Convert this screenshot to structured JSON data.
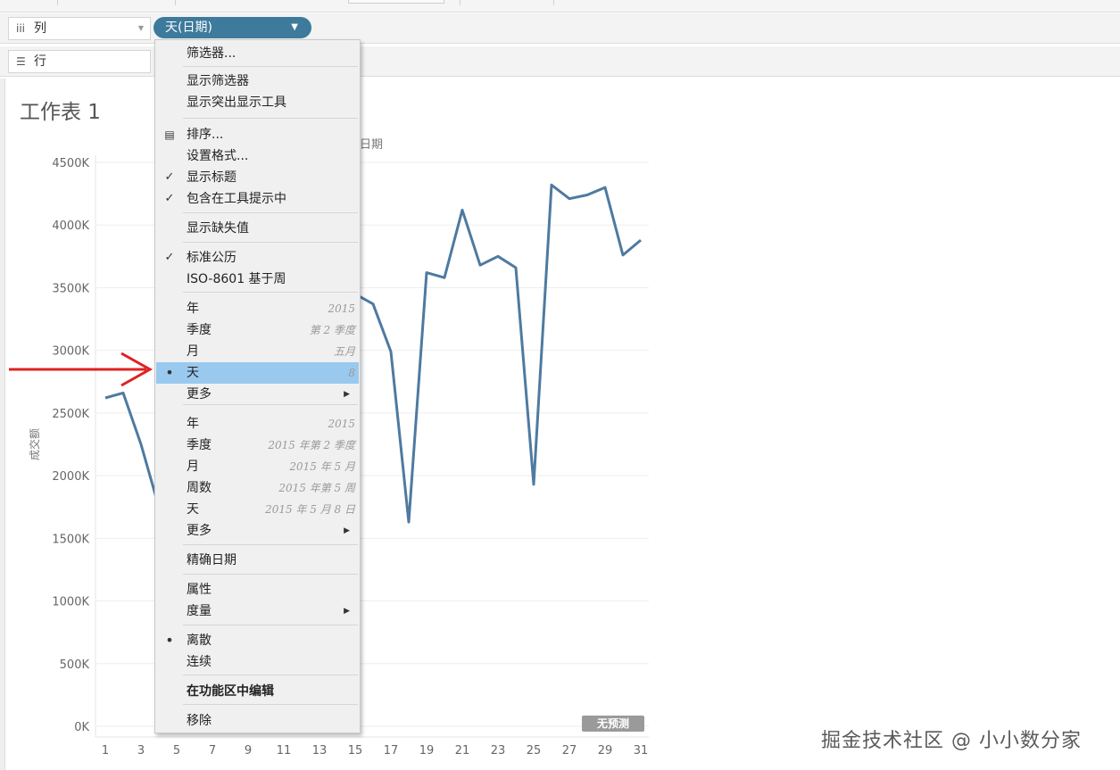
{
  "shelves": {
    "columns": {
      "icon": "columns-icon",
      "label": "列"
    },
    "rows": {
      "icon": "rows-icon",
      "label": "行"
    },
    "pill_label": "天(日期)"
  },
  "sheet": {
    "title": "工作表 1"
  },
  "colors": {
    "accent": "#3d7a9c",
    "line": "#4e7aa0",
    "highlight": "#99c9ef",
    "arrow": "#e02020"
  },
  "menu": {
    "items": [
      {
        "id": "filter",
        "label": "筛选器..."
      },
      {
        "id": "show-filter",
        "label": "显示筛选器"
      },
      {
        "id": "show-highlighter",
        "label": "显示突出显示工具"
      },
      {
        "id": "sort",
        "label": "排序...",
        "icon": "sort-icon"
      },
      {
        "id": "format",
        "label": "设置格式..."
      },
      {
        "id": "show-header",
        "label": "显示标题",
        "checked": true
      },
      {
        "id": "include-tooltip",
        "label": "包含在工具提示中",
        "checked": true
      },
      {
        "id": "show-missing",
        "label": "显示缺失值"
      },
      {
        "id": "standard-calendar",
        "label": "标准公历",
        "checked": true
      },
      {
        "id": "iso-8601",
        "label": "ISO-8601 基于周"
      },
      {
        "id": "year-part",
        "label": "年",
        "hint": "2015"
      },
      {
        "id": "quarter-part",
        "label": "季度",
        "hint": "第 2 季度"
      },
      {
        "id": "month-part",
        "label": "月",
        "hint": "五月"
      },
      {
        "id": "day-part",
        "label": "天",
        "hint": "8",
        "selected": true
      },
      {
        "id": "more-part",
        "label": "更多",
        "submenu": true
      },
      {
        "id": "year-value",
        "label": "年",
        "hint": "2015"
      },
      {
        "id": "quarter-value",
        "label": "季度",
        "hint": "2015 年第 2 季度"
      },
      {
        "id": "month-value",
        "label": "月",
        "hint": "2015 年 5 月"
      },
      {
        "id": "week-value",
        "label": "周数",
        "hint": "2015 年第 5 周"
      },
      {
        "id": "day-value",
        "label": "天",
        "hint": "2015 年 5 月 8 日"
      },
      {
        "id": "more-value",
        "label": "更多",
        "submenu": true
      },
      {
        "id": "exact-date",
        "label": "精确日期"
      },
      {
        "id": "attribute",
        "label": "属性"
      },
      {
        "id": "measure",
        "label": "度量",
        "submenu": true
      },
      {
        "id": "discrete",
        "label": "离散",
        "selected": true
      },
      {
        "id": "continuous",
        "label": "连续"
      },
      {
        "id": "edit-in-shelf",
        "label": "在功能区中编辑",
        "bold": true
      },
      {
        "id": "remove",
        "label": "移除"
      }
    ]
  },
  "chart_data": {
    "type": "line",
    "title": "",
    "xlabel": "日期",
    "ylabel": "成交额",
    "x": [
      1,
      2,
      3,
      4,
      5,
      6,
      7,
      8,
      9,
      10,
      11,
      12,
      13,
      14,
      15,
      16,
      17,
      18,
      19,
      20,
      21,
      22,
      23,
      24,
      25,
      26,
      27,
      28,
      29,
      30,
      31
    ],
    "x_ticks": [
      "1",
      "3",
      "5",
      "7",
      "9",
      "11",
      "13",
      "15",
      "17",
      "19",
      "21",
      "23",
      "25",
      "27",
      "29",
      "31"
    ],
    "y_ticks": [
      "0K",
      "500K",
      "1000K",
      "1500K",
      "2000K",
      "2500K",
      "3000K",
      "3500K",
      "4000K",
      "4500K"
    ],
    "ylim": [
      0,
      4500000
    ],
    "series": [
      {
        "values": [
          2620000,
          2660000,
          2250000,
          1750000,
          null,
          null,
          null,
          null,
          null,
          null,
          null,
          null,
          null,
          null,
          3450000,
          3370000,
          2990000,
          1630000,
          3620000,
          3580000,
          4120000,
          3680000,
          3750000,
          3660000,
          1930000,
          4320000,
          4210000,
          4240000,
          4300000,
          3760000,
          3880000
        ]
      }
    ],
    "badge": "无预测"
  },
  "watermark": "掘金技术社区 @ 小小数分家"
}
